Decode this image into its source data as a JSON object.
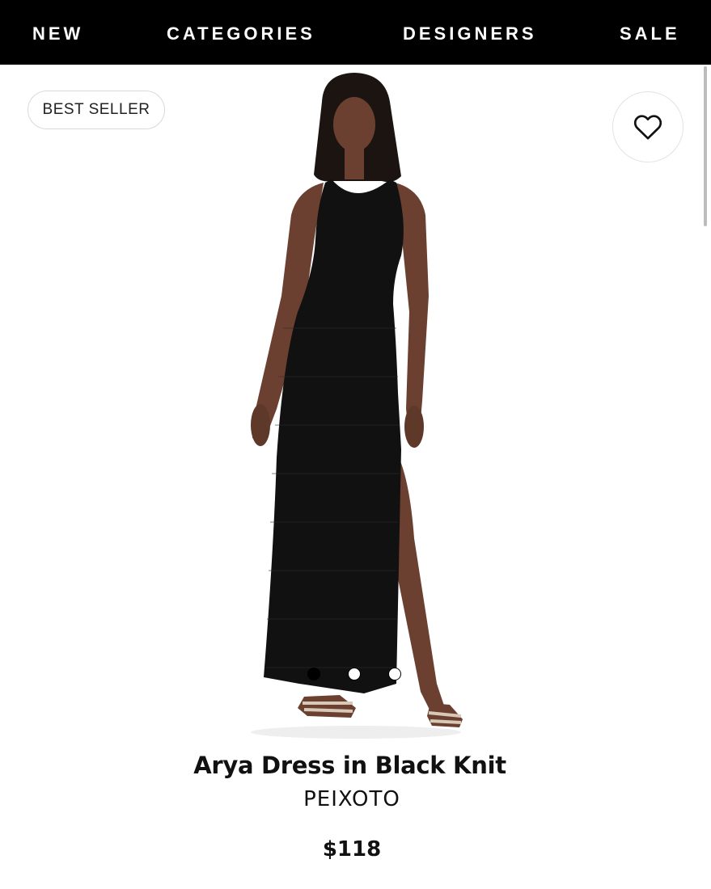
{
  "nav": {
    "items": [
      "NEW",
      "CATEGORIES",
      "DESIGNERS",
      "SALE"
    ]
  },
  "badge": {
    "label": "BEST SELLER"
  },
  "favorite": {
    "icon": "heart-outline-icon"
  },
  "carousel": {
    "total": 3,
    "active": 1
  },
  "product": {
    "title": "Arya Dress in Black Knit",
    "brand": "PEIXOTO",
    "price": "$118"
  },
  "colors": {
    "nav_bg": "#000000",
    "nav_text": "#ffffff",
    "page_bg": "#ffffff"
  }
}
